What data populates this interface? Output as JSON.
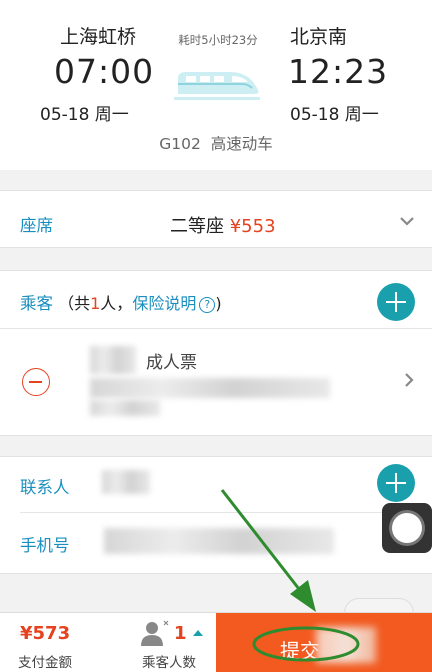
{
  "trip": {
    "from_station": "上海虹桥",
    "to_station": "北京南",
    "depart_time": "07:00",
    "arrive_time": "12:23",
    "depart_date": "05-18 周一",
    "arrive_date": "05-18 周一",
    "duration": "耗时5小时23分",
    "train_no": "G102",
    "train_type": "高速动车"
  },
  "seat": {
    "label": "座席",
    "class": "二等座",
    "price": "¥553"
  },
  "passengers": {
    "label": "乘客",
    "count_prefix": "（共",
    "count": "1",
    "count_suffix": "人，",
    "insurance_link": "保险说明",
    "help_mark": "?",
    "ticket_type": "成人票"
  },
  "contact": {
    "label": "联系人",
    "phone_label": "手机号"
  },
  "footer": {
    "amount": "¥573",
    "amount_label": "支付金额",
    "passenger_count": "1",
    "passenger_count_label": "乘客人数",
    "submit_label": "提交"
  },
  "colors": {
    "accent": "#1a8fbf",
    "price": "#e5421f",
    "submit": "#f25a1f",
    "plus_button": "#1aa0ad"
  },
  "icons": [
    "train-icon",
    "chevron-down-icon",
    "plus-icon",
    "minus-icon",
    "help-icon",
    "chevron-right-icon",
    "person-icon",
    "up-arrow-icon",
    "assistive-touch-icon"
  ]
}
